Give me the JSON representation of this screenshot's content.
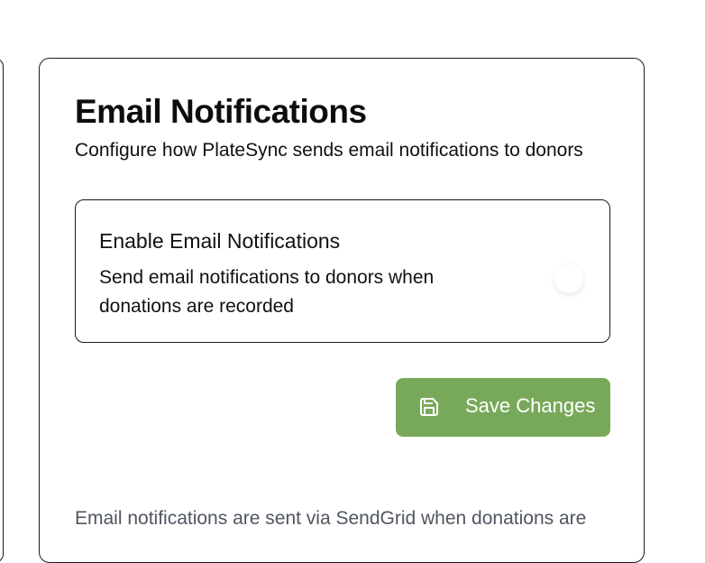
{
  "email_notifications": {
    "title": "Email Notifications",
    "subtitle": "Configure how PlateSync sends email notifications to donors",
    "setting": {
      "title": "Enable Email Notifications",
      "description": "Send email notifications to donors when donations are recorded",
      "enabled": false
    },
    "save_button": {
      "label": "Save Changes",
      "icon": "save-icon",
      "color": "#78a95a"
    },
    "footer_note": "Email notifications are sent via SendGrid when donations are"
  }
}
